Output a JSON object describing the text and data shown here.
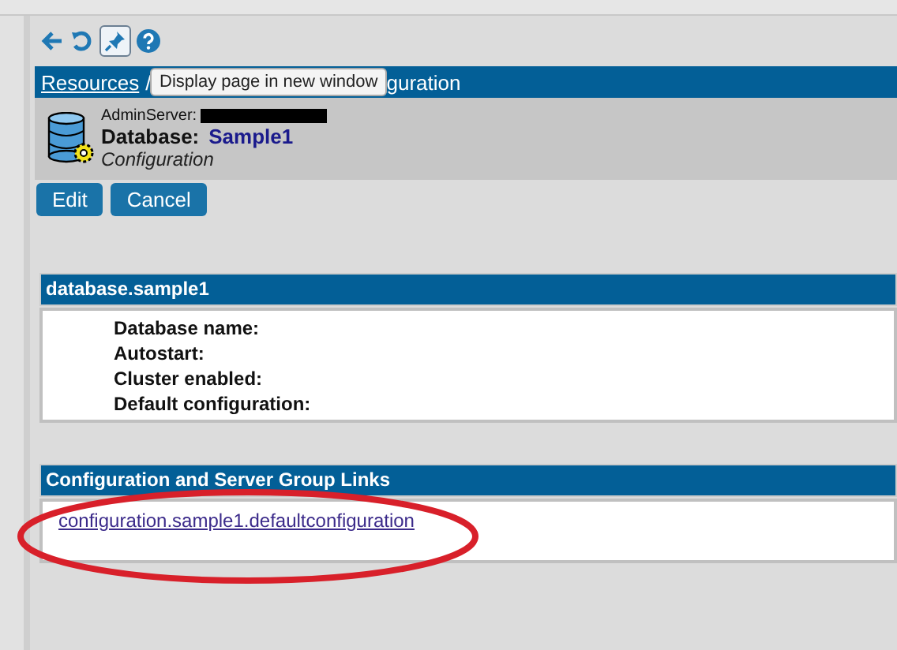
{
  "toolbar": {
    "tooltip": "Display page in new window",
    "pin_pressed": true
  },
  "breadcrumb": {
    "link": "Resources",
    "separator": "/",
    "tail": "guration"
  },
  "header": {
    "server_label": "AdminServer:",
    "title_label": "Database:",
    "title_value": "Sample1",
    "subtitle": "Configuration"
  },
  "buttons": [
    "Edit",
    "Cancel"
  ],
  "database_section": {
    "title": "database.sample1",
    "fields": [
      "Database name:",
      "Autostart:",
      "Cluster enabled:",
      "Default configuration:"
    ]
  },
  "links_section": {
    "title": "Configuration and Server Group Links",
    "links": [
      "configuration.sample1.defaultconfiguration"
    ]
  }
}
